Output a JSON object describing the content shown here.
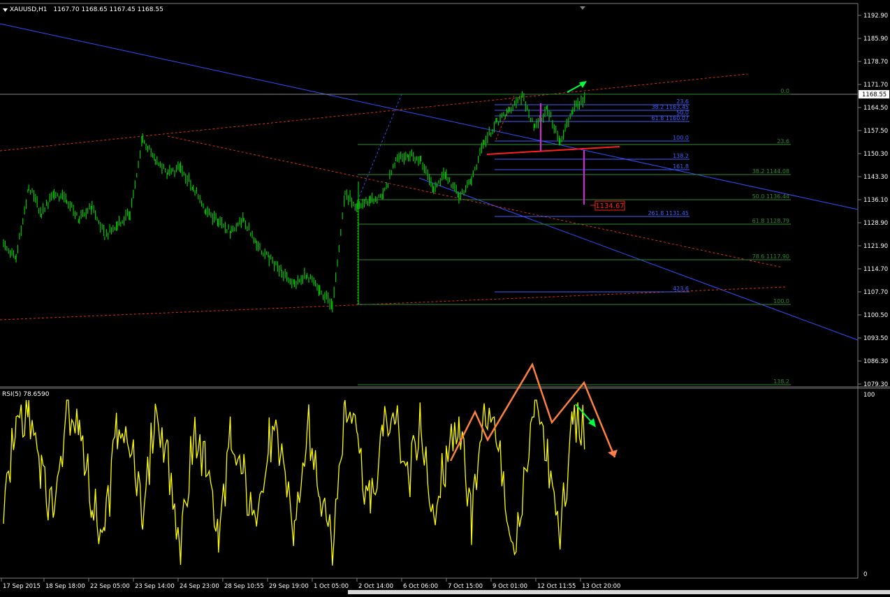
{
  "header": {
    "symbol": "XAUUSD,H1",
    "ohlc": "1167.70 1168.65 1167.45 1168.55"
  },
  "rsi_header": {
    "label": "RSI(5) 78.6590"
  },
  "price_axis": {
    "ticks": [
      "1192.90",
      "1185.90",
      "1178.70",
      "1171.70",
      "1164.50",
      "1157.50",
      "1150.30",
      "1143.30",
      "1136.10",
      "1128.90",
      "1121.90",
      "1114.70",
      "1107.70",
      "1100.50",
      "1093.50",
      "1086.30",
      "1079.30"
    ],
    "current_price": "1168.55"
  },
  "rsi_axis": {
    "top": "100",
    "bottom": "0"
  },
  "time_axis": {
    "labels": [
      "17 Sep 2015",
      "18 Sep 18:00",
      "22 Sep 05:00",
      "23 Sep 14:00",
      "24 Sep 23:00",
      "28 Sep 10:55",
      "29 Sep 19:00",
      "1 Oct 05:00",
      "2 Oct 14:00",
      "6 Oct 06:00",
      "7 Oct 15:00",
      "9 Oct 01:00",
      "12 Oct 11:55",
      "13 Oct 20:00"
    ]
  },
  "fib_primary": [
    {
      "level": "0.0"
    },
    {
      "level": "23.6"
    },
    {
      "level": "38.2 1144.08"
    },
    {
      "level": "50.0 1136.44"
    },
    {
      "level": "61.8 1128.79"
    },
    {
      "level": "78.6 1117.90"
    },
    {
      "level": "100.0"
    },
    {
      "level": "138.2"
    }
  ],
  "fib_secondary": [
    {
      "level": "23.6"
    },
    {
      "level": "38.2 1163.45"
    },
    {
      "level": "50.0"
    },
    {
      "level": "61.8 1160.07"
    },
    {
      "level": "100.0"
    },
    {
      "level": "138.2"
    },
    {
      "level": "161.8"
    },
    {
      "level": "261.8 1131.45"
    },
    {
      "level": "423.6"
    }
  ],
  "target_label": "1134.67",
  "colors": {
    "background": "#000000",
    "candles": "#00c800",
    "rsi": "#ffff00",
    "fib_primary": "#2e8b2e",
    "fib_secondary": "#4060ff",
    "trend_blue": "#3050ff",
    "trend_red": "#e03010",
    "magenta": "#e020e0",
    "orange": "#ff8040",
    "lime_arrow": "#00ff40",
    "target_red": "#ff2020"
  },
  "chart_data": {
    "type": "line",
    "series": [
      {
        "values": [
          1122,
          1118,
          1140,
          1132,
          1138,
          1136,
          1130,
          1134,
          1125,
          1128,
          1132,
          1155,
          1148,
          1144,
          1146,
          1140,
          1132,
          1130,
          1126,
          1130,
          1122,
          1118,
          1114,
          1110,
          1113,
          1108,
          1104,
          1138,
          1134,
          1136,
          1137,
          1148,
          1150,
          1148,
          1140,
          1144,
          1137,
          1142,
          1154,
          1160,
          1163,
          1168,
          1158,
          1164,
          1154,
          1164,
          1168
        ]
      },
      {
        "values": [
          40,
          85,
          95,
          60,
          30,
          92,
          88,
          40,
          20,
          85,
          78,
          25,
          95,
          65,
          15,
          80,
          60,
          20,
          80,
          55,
          15,
          75,
          70,
          20,
          88,
          50,
          10,
          95,
          72,
          35,
          82,
          92,
          50,
          88,
          35,
          65,
          90,
          30,
          88,
          80,
          10,
          40,
          95,
          62,
          20,
          88,
          80
        ]
      }
    ],
    "xlabel": "",
    "ylabel": "",
    "ylim": [
      1079.3,
      1192.9
    ]
  }
}
